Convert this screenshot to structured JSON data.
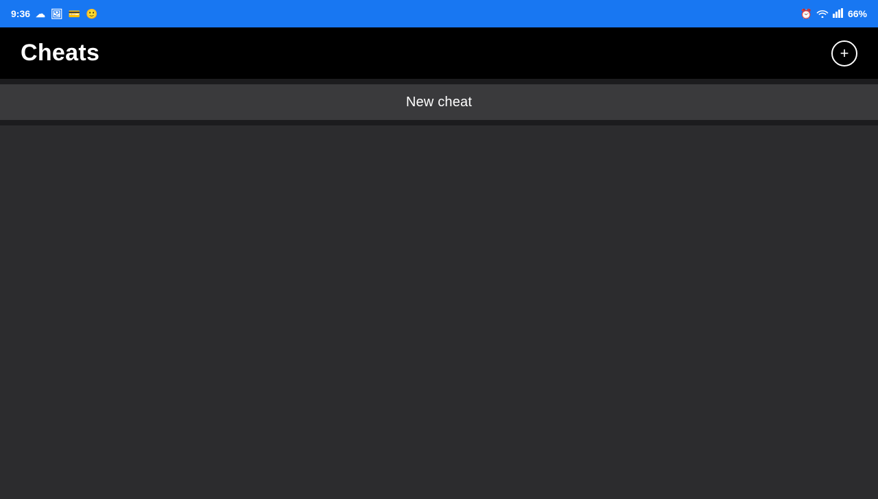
{
  "status_bar": {
    "time": "9:36",
    "battery": "66%",
    "icons_left": [
      "alarm-icon",
      "cloud-icon",
      "image-icon",
      "card-icon",
      "face-icon"
    ],
    "icons_right": [
      "alarm-clock-icon",
      "wifi-icon",
      "signal-icon",
      "battery-icon"
    ]
  },
  "header": {
    "title": "Cheats",
    "add_button_label": "+"
  },
  "main": {
    "new_cheat_label": "New cheat"
  }
}
